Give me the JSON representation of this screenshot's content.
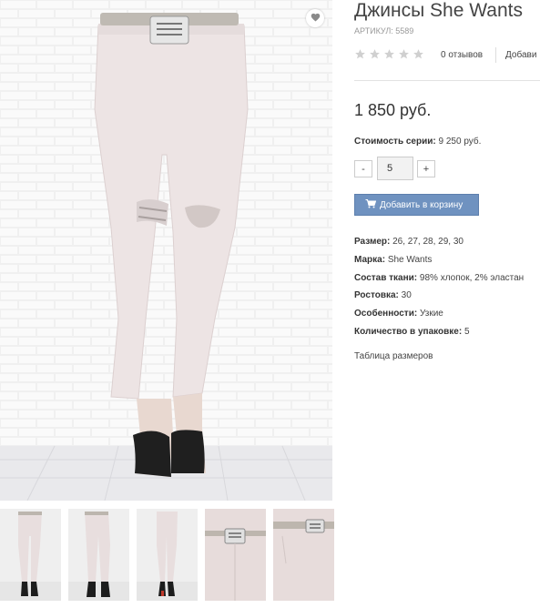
{
  "product": {
    "title": "Джинсы She Wants",
    "sku_label": "АРТИКУЛ:",
    "sku_value": "5589",
    "rating": 0,
    "reviews_label": "0 отзывов",
    "add_review_label": "Добави",
    "price": "1 850 руб.",
    "series_label": "Стоимость серии:",
    "series_value": "9 250 руб.",
    "qty_minus": "-",
    "qty_value": "5",
    "qty_plus": "+",
    "add_to_cart_label": "Добавить в корзину",
    "specs": [
      {
        "label": "Размер:",
        "value": "26, 27, 28, 29, 30"
      },
      {
        "label": "Марка:",
        "value": "She Wants"
      },
      {
        "label": "Состав ткани:",
        "value": "98% хлопок, 2% эластан"
      },
      {
        "label": "Ростовка:",
        "value": "30"
      },
      {
        "label": "Особенности:",
        "value": "Узкие"
      },
      {
        "label": "Количество в упаковке:",
        "value": "5"
      }
    ],
    "size_table_label": "Таблица размеров"
  },
  "icons": {
    "favorite": "heart-icon",
    "star": "star-icon",
    "cart": "cart-icon"
  },
  "colors": {
    "accent_button": "#6f92c0",
    "star_empty": "#d0d0d0",
    "text": "#444444"
  }
}
